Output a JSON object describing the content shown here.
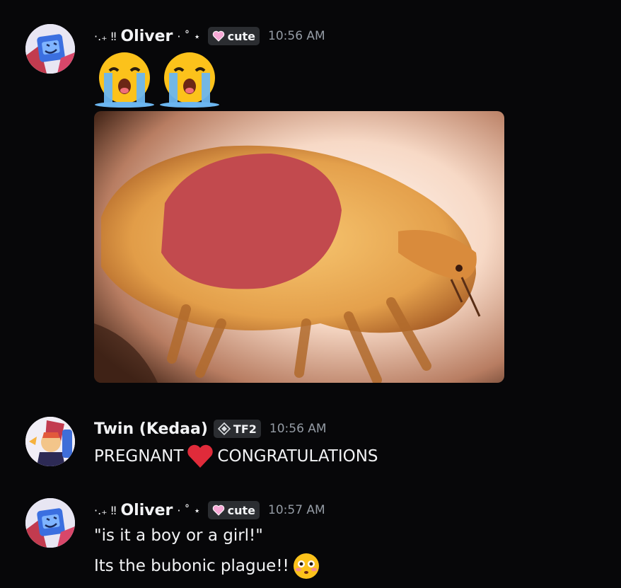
{
  "messages": [
    {
      "author": "Oliver",
      "prefix": "·.₊ ‼",
      "suffix": "· ˚ ⋆",
      "tag": "cute",
      "tag_icon": "pink-heart-icon",
      "time": "10:56 AM",
      "emojis": [
        "loudly-crying-face-icon",
        "loudly-crying-face-icon"
      ],
      "attachment": "flea-microscope-image"
    },
    {
      "author": "Twin (Kedaa)",
      "tag": "TF2",
      "tag_icon": "compass-diamond-icon",
      "time": "10:56 AM",
      "text_before": "PREGNANT",
      "text_after": "CONGRATULATIONS",
      "inline_emoji": "red-heart-icon"
    },
    {
      "author": "Oliver",
      "prefix": "·.₊ ‼",
      "suffix": "· ˚ ⋆",
      "tag": "cute",
      "tag_icon": "pink-heart-icon",
      "time": "10:57 AM",
      "lines": [
        "\"is it a boy or a girl!\"",
        "Its the bubonic plague!!"
      ],
      "inline_emoji": "flushed-face-icon"
    }
  ],
  "colors": {
    "background": "#070709",
    "tag_bg": "#2b2d31",
    "timestamp": "#949ba4"
  }
}
